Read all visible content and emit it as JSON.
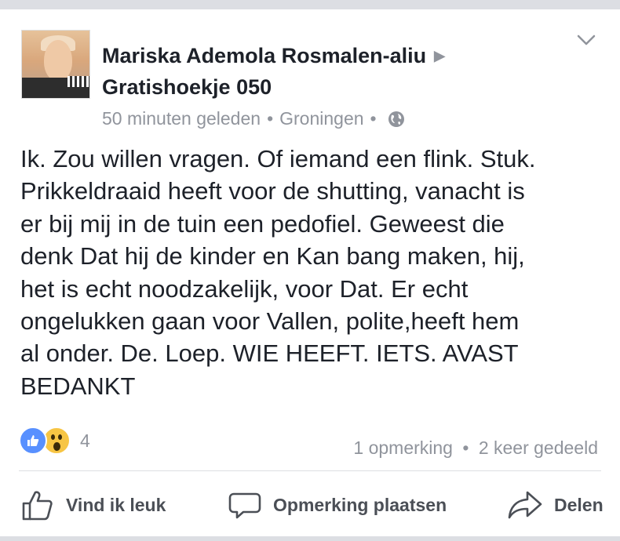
{
  "post": {
    "author": "Mariska Ademola Rosmalen-aliu",
    "group": "Gratishoekje 050",
    "time": "50 minuten geleden",
    "location": "Groningen",
    "separator": "•",
    "body_lines": [
      "Ik. Zou willen vragen. Of iemand een flink. Stuk.",
      "Prikkeldraaid heeft voor de shutting, vanacht is",
      "er bij mij in de tuin een pedofiel. Geweest die",
      "denk Dat hij de kinder en Kan bang maken, hij,",
      "het is echt noodzakelijk, voor Dat. Er echt",
      "ongelukken gaan voor Vallen, polite,heeft hem",
      "al onder. De. Loep. WIE HEEFT. IETS. AVAST",
      "BEDANKT"
    ],
    "reaction_count": "4",
    "comments": "1 opmerking",
    "shares": "2 keer gedeeld"
  },
  "actions": {
    "like": "Vind ik leuk",
    "comment": "Opmerking plaatsen",
    "share": "Delen"
  },
  "icons": {
    "menu": "chevron-down-icon",
    "audience": "globe-icon",
    "like": "thumbs-up-icon",
    "comment": "speech-bubble-icon",
    "share": "share-arrow-icon"
  },
  "colors": {
    "text": "#1d2129",
    "meta": "#90949c",
    "like_blue": "#5890ff",
    "wow_yellow": "#f7c544"
  }
}
